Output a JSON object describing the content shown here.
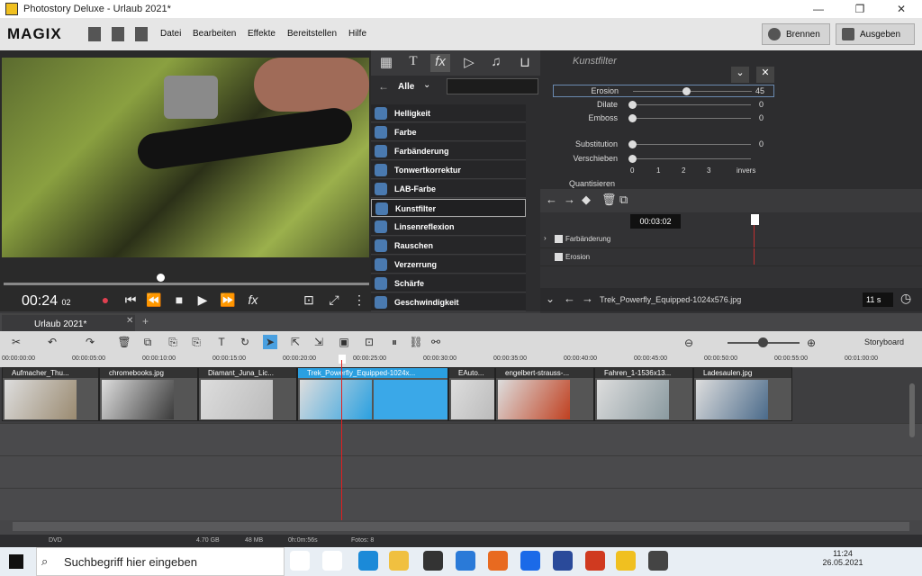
{
  "window": {
    "title": "Photostory Deluxe - Urlaub 2021*"
  },
  "menu": {
    "brand": "MAGIX",
    "items": [
      "Datei",
      "Bearbeiten",
      "Effekte",
      "Bereitstellen",
      "Hilfe"
    ],
    "burn": "Brennen",
    "export": "Ausgeben"
  },
  "preview": {
    "timecode": "00:24",
    "frames": "02"
  },
  "effects": {
    "filter_label": "Alle",
    "list": [
      "Helligkeit",
      "Farbe",
      "Farbänderung",
      "Tonwertkorrektur",
      "LAB-Farbe",
      "Kunstfilter",
      "Linsenreflexion",
      "Rauschen",
      "Verzerrung",
      "Schärfe",
      "Geschwindigkeit"
    ],
    "selected": "Kunstfilter"
  },
  "props": {
    "header": "Kunstfilter",
    "rows": [
      {
        "label": "Erosion",
        "value": "45",
        "level": 0.45
      },
      {
        "label": "Dilate",
        "value": "0",
        "level": 0
      },
      {
        "label": "Emboss",
        "value": "0",
        "level": 0
      },
      {
        "label": "Substitution",
        "value": "0",
        "level": 0
      },
      {
        "label": "Verschieben",
        "value": "",
        "level": 0
      }
    ],
    "scale": [
      "0",
      "1",
      "2",
      "3",
      "invers"
    ],
    "quantize": "Quantisieren"
  },
  "keyframes": {
    "time": "00:03:02",
    "rows": [
      "Farbänderung",
      "Erosion"
    ],
    "filename": "Trek_Powerfly_Equipped-1024x576.jpg",
    "duration": "11 s"
  },
  "timeline": {
    "tab": "Urlaub 2021*",
    "storyboard": "Storyboard",
    "ruler": [
      "00:00:00:00",
      "00:00:05:00",
      "00:00:10:00",
      "00:00:15:00",
      "00:00:20:00",
      "00:00:25:00",
      "00:00:30:00",
      "00:00:35:00",
      "00:00:40:00",
      "00:00:45:00",
      "00:00:50:00",
      "00:00:55:00",
      "00:01:00:00"
    ],
    "clips": [
      "Aufmacher_Thu...",
      "chromebooks.jpg",
      "Diamant_Juna_Lic...",
      "Trek_Powerfly_Equipped-1024x...",
      "EAuto...",
      "engelbert-strauss-...",
      "Fahren_1-1536x13...",
      "Ladesaulen.jpg"
    ]
  },
  "status": {
    "mode": "DVD",
    "size": "4.70 GB",
    "mem": "48 MB",
    "duration": "0h:0m:56s",
    "photos": "Fotos: 8"
  },
  "taskbar": {
    "search": "Suchbegriff hier eingeben",
    "time": "11:24",
    "date": "26.05.2021"
  }
}
